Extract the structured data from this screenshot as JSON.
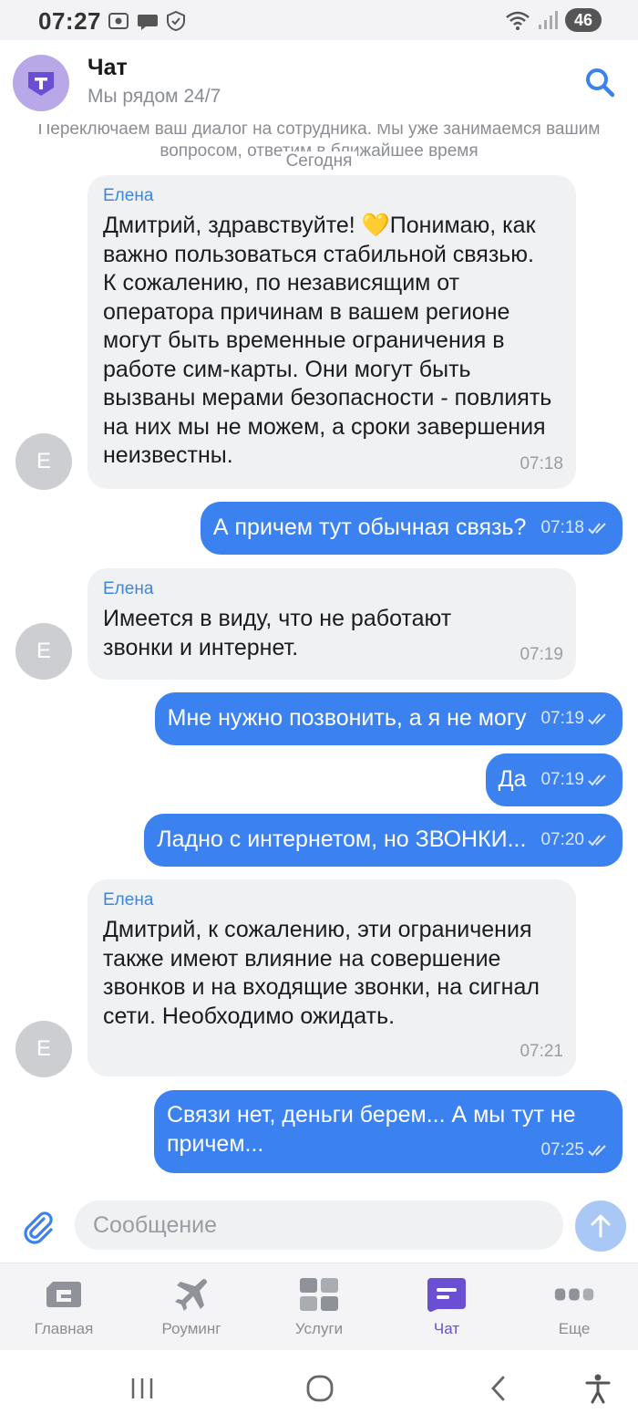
{
  "statusbar": {
    "time": "07:27",
    "battery": "46"
  },
  "header": {
    "title": "Чат",
    "subtitle": "Мы рядом 24/7"
  },
  "chat": {
    "system_note": "Переключаем ваш диалог на сотрудника. Мы уже занимаемся вашим вопросом, ответим в ближайшее время",
    "date_separator": "Сегодня",
    "messages": [
      {
        "dir": "in",
        "author": "Елена",
        "avatar": "Е",
        "text": "Дмитрий, здравствуйте! 💛Понимаю, как важно пользоваться стабильной связью. К сожалению, по независящим от оператора причинам в вашем регионе могут быть временные ограничения в работе сим-карты. Они могут быть вызваны мерами безопасности - повлиять на них мы не можем, а сроки завершения неизвестны.",
        "time": "07:18"
      },
      {
        "dir": "out",
        "text": "А причем тут обычная связь?",
        "time": "07:18"
      },
      {
        "dir": "in",
        "author": "Елена",
        "avatar": "Е",
        "text": "Имеется в виду, что не работают звонки и интернет.",
        "time": "07:19"
      },
      {
        "dir": "out",
        "text": "Мне нужно позвонить, а я не могу",
        "time": "07:19"
      },
      {
        "dir": "out",
        "text": "Да",
        "time": "07:19"
      },
      {
        "dir": "out",
        "text": "Ладно с интернетом, но ЗВОНКИ...",
        "time": "07:20"
      },
      {
        "dir": "in",
        "author": "Елена",
        "avatar": "Е",
        "text": "Дмитрий, к сожалению, эти ограничения также имеют влияние на совершение звонков и на входящие звонки, на сигнал сети. Необходимо ожидать.",
        "time": "07:21"
      },
      {
        "dir": "out",
        "text": "Связи нет, деньги берем... А мы тут не причем...",
        "time": "07:25"
      }
    ]
  },
  "composer": {
    "placeholder": "Сообщение"
  },
  "tabs": [
    {
      "label": "Главная",
      "icon": "home-card-icon",
      "active": false
    },
    {
      "label": "Роуминг",
      "icon": "airplane-icon",
      "active": false
    },
    {
      "label": "Услуги",
      "icon": "grid-icon",
      "active": false
    },
    {
      "label": "Чат",
      "icon": "chat-icon",
      "active": true
    },
    {
      "label": "Еще",
      "icon": "more-icon",
      "active": false
    }
  ],
  "colors": {
    "accent": "#3b82f0",
    "active_tab": "#6a4fd4",
    "author": "#3d86de",
    "incoming_bg": "#f0f1f3"
  }
}
